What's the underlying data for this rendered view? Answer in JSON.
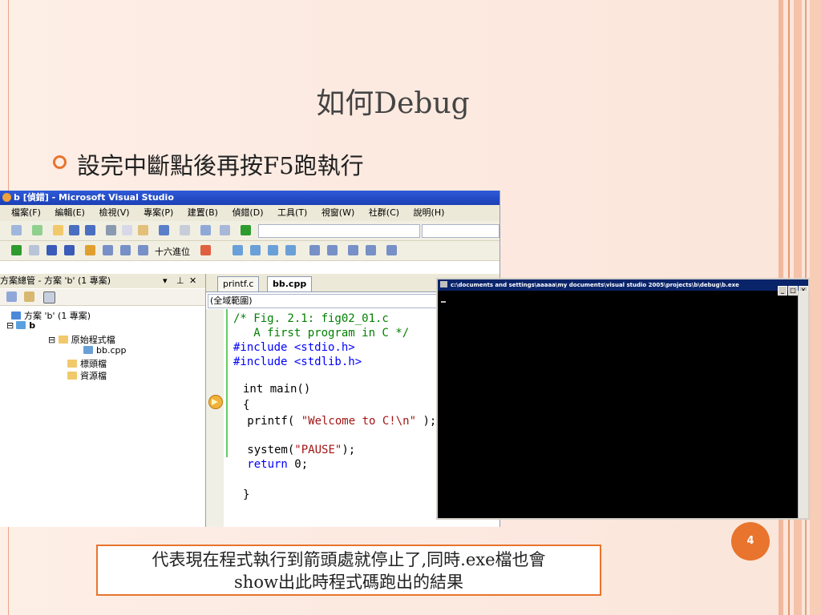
{
  "slide": {
    "title": "如何Debug",
    "bullet": "設完中斷點後再按F5跑執行",
    "page_number": "4",
    "callout_line1": "代表現在程式執行到箭頭處就停止了,同時.exe檔也會",
    "callout_line2": "show出此時程式碼跑出的結果",
    "accent_color": "#e8742d"
  },
  "vs": {
    "window_title": "b [偵錯] - Microsoft Visual Studio",
    "menu": [
      "檔案(F)",
      "編輯(E)",
      "檢視(V)",
      "專案(P)",
      "建置(B)",
      "偵錯(D)",
      "工具(T)",
      "視窗(W)",
      "社群(C)",
      "說明(H)"
    ],
    "hex_label": "十六進位",
    "solution_explorer_title": "方案總管 - 方案 'b' (1 專案)",
    "tree": {
      "solution": "方案 'b' (1 專案)",
      "project": "b",
      "source_folder": "原始程式檔",
      "file": "bb.cpp",
      "header_folder": "標頭檔",
      "resource_folder": "資源檔"
    },
    "tabs": [
      "printf.c",
      "bb.cpp"
    ],
    "scope_combo": "(全域範圍)",
    "code": {
      "l1": "/* Fig. 2.1: fig02_01.c",
      "l2": "   A first program in C */",
      "l3": "#include <stdio.h>",
      "l4": "#include <stdlib.h>",
      "l5": "int main()",
      "l6": "{",
      "l7a": "   printf( ",
      "l7b": "\"Welcome to C!\\n\"",
      "l7c": " );",
      "l8a": "   system(",
      "l8b": "\"PAUSE\"",
      "l8c": ");",
      "l9a": "   return",
      "l9b": " 0;",
      "l10": "}"
    }
  },
  "console": {
    "title": "c:\\documents and settings\\aaaaa\\my documents\\visual studio 2005\\projects\\b\\debug\\b.exe"
  }
}
